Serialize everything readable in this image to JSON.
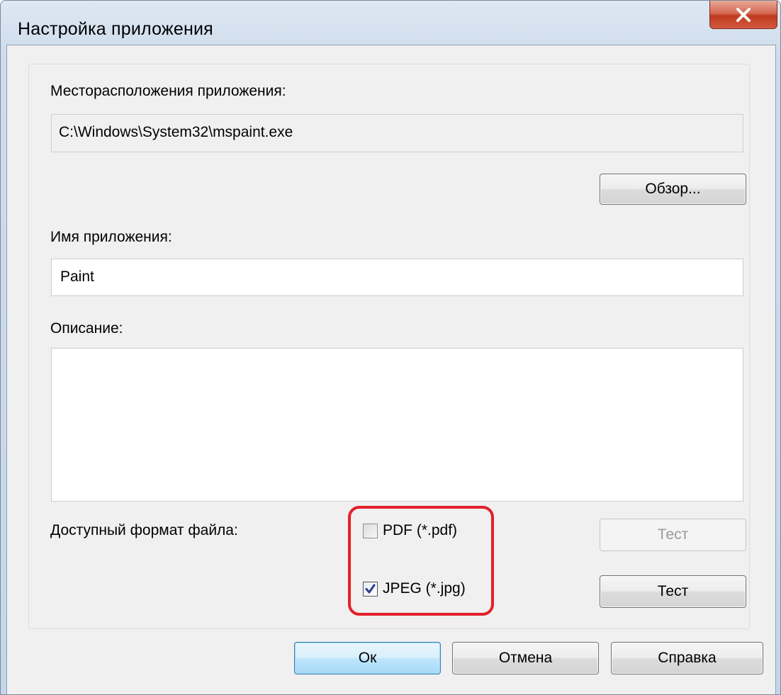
{
  "window": {
    "title": "Настройка приложения"
  },
  "location": {
    "label": "Месторасположения приложения:",
    "value": "C:\\Windows\\System32\\mspaint.exe",
    "browse_button": "Обзор..."
  },
  "app_name": {
    "label": "Имя приложения:",
    "value": "Paint"
  },
  "description": {
    "label": "Описание:",
    "value": ""
  },
  "formats": {
    "label": "Доступный формат файла:",
    "items": [
      {
        "label": "PDF (*.pdf)",
        "checked": false,
        "test_button": "Тест",
        "test_enabled": false
      },
      {
        "label": "JPEG (*.jpg)",
        "checked": true,
        "test_button": "Тест",
        "test_enabled": true
      }
    ]
  },
  "footer": {
    "ok_button": "Ок",
    "cancel_button": "Отмена",
    "help_button": "Справка"
  },
  "icons": {
    "close": "close-icon",
    "checkmark": "checkmark-icon"
  },
  "colors": {
    "highlight": "#e3202a",
    "close_button": "#c0391f",
    "default_button_border": "#3c7fb1"
  }
}
